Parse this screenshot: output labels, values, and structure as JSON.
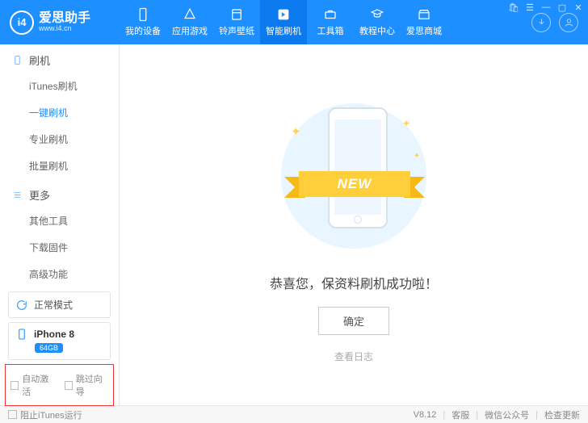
{
  "app": {
    "name": "爱思助手",
    "url": "www.i4.cn",
    "logoGlyph": "i4"
  },
  "nav": [
    {
      "label": "我的设备",
      "key": "device"
    },
    {
      "label": "应用游戏",
      "key": "apps"
    },
    {
      "label": "铃声壁纸",
      "key": "ring"
    },
    {
      "label": "智能刷机",
      "key": "flash",
      "active": true
    },
    {
      "label": "工具箱",
      "key": "tools"
    },
    {
      "label": "教程中心",
      "key": "tutorial"
    },
    {
      "label": "爱思商城",
      "key": "store"
    }
  ],
  "sidebar": {
    "sections": [
      {
        "title": "刷机",
        "icon": "phone",
        "items": [
          {
            "label": "iTunes刷机"
          },
          {
            "label": "一键刷机",
            "active": true
          },
          {
            "label": "专业刷机"
          },
          {
            "label": "批量刷机"
          }
        ]
      },
      {
        "title": "更多",
        "icon": "menu",
        "items": [
          {
            "label": "其他工具"
          },
          {
            "label": "下载固件"
          },
          {
            "label": "高级功能"
          }
        ]
      }
    ],
    "modeCard": {
      "label": "正常模式"
    },
    "deviceCard": {
      "name": "iPhone 8",
      "badge": "64GB"
    },
    "options": [
      {
        "label": "自动激活"
      },
      {
        "label": "跳过向导"
      }
    ]
  },
  "main": {
    "ribbon": "NEW",
    "message": "恭喜您，保资料刷机成功啦！",
    "okButton": "确定",
    "logLink": "查看日志"
  },
  "footer": {
    "stopItunes": "阻止iTunes运行",
    "version": "V8.12",
    "links": [
      "客服",
      "微信公众号",
      "检查更新"
    ]
  }
}
